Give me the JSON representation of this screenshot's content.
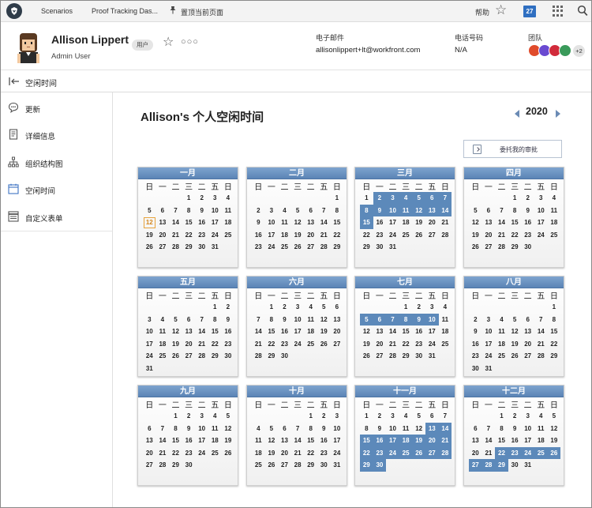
{
  "topnav": {
    "tabs": [
      "Scenarios",
      "Proof Tracking Das..."
    ],
    "pin_label": "置顶当前页面",
    "help": "帮助",
    "calendar_badge": "27"
  },
  "user": {
    "name": "Allison Lippert",
    "role": "Admin User",
    "pill": "用户",
    "email_label": "电子邮件",
    "email": "allisonlippert+lt@workfront.com",
    "phone_label": "电话号码",
    "phone": "N/A",
    "team_label": "团队",
    "team_more": "+2",
    "team_colors": [
      "#e04b2b",
      "#6a4ad1",
      "#d12b3b",
      "#3a9a5a"
    ]
  },
  "section": {
    "title": "空闲时间"
  },
  "sidebar": {
    "items": [
      {
        "label": "更新",
        "icon": "chat-bubble-icon"
      },
      {
        "label": "详细信息",
        "icon": "document-icon"
      },
      {
        "label": "组织结构图",
        "icon": "org-chart-icon"
      },
      {
        "label": "空闲时间",
        "icon": "calendar-icon"
      },
      {
        "label": "自定义表单",
        "icon": "form-icon"
      }
    ]
  },
  "main": {
    "title": "Allison's 个人空闲时间",
    "year": "2020",
    "delegate_button": "委托我的审批"
  },
  "colors": {
    "header_blue": "#5b84b5",
    "selected_day": "#5c89ba",
    "today_outline": "#e7a23c"
  },
  "calendar": {
    "weekday_headers": [
      "日",
      "一",
      "二",
      "三",
      "二",
      "五",
      "日"
    ],
    "months": [
      {
        "name": "一月",
        "offset": 3,
        "days": 31,
        "selected": [],
        "today": 12
      },
      {
        "name": "二月",
        "offset": 6,
        "days": 29,
        "selected": []
      },
      {
        "name": "三月",
        "offset": 0,
        "days": 31,
        "selected": [
          2,
          3,
          4,
          5,
          6,
          7,
          8,
          9,
          10,
          11,
          12,
          13,
          14,
          15
        ]
      },
      {
        "name": "四月",
        "offset": 3,
        "days": 30,
        "selected": []
      },
      {
        "name": "五月",
        "offset": 5,
        "days": 31,
        "selected": []
      },
      {
        "name": "六月",
        "offset": 1,
        "days": 30,
        "selected": []
      },
      {
        "name": "七月",
        "offset": 3,
        "days": 31,
        "selected": [
          5,
          6,
          7,
          8,
          9,
          10
        ]
      },
      {
        "name": "八月",
        "offset": 6,
        "days": 31,
        "selected": []
      },
      {
        "name": "九月",
        "offset": 2,
        "days": 30,
        "selected": []
      },
      {
        "name": "十月",
        "offset": 4,
        "days": 31,
        "selected": []
      },
      {
        "name": "十一月",
        "offset": 0,
        "days": 30,
        "selected": [
          13,
          14,
          15,
          16,
          17,
          18,
          19,
          20,
          21,
          22,
          23,
          24,
          25,
          26,
          27,
          28,
          29,
          30
        ]
      },
      {
        "name": "十二月",
        "offset": 2,
        "days": 31,
        "selected": [
          22,
          23,
          24,
          25,
          26,
          27,
          28,
          29
        ]
      }
    ]
  }
}
